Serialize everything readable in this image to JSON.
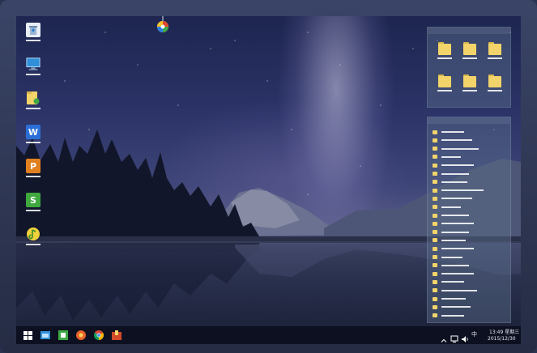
{
  "desktop": {
    "icons": [
      {
        "name": "recycle-bin-icon",
        "color": "#e8eef6"
      },
      {
        "name": "computer-icon",
        "color": "#2f8fd8"
      },
      {
        "name": "user-folder-icon",
        "color": "#f2d46a"
      },
      {
        "name": "wps-writer-icon",
        "color": "#2b6fd6",
        "glyph": "W"
      },
      {
        "name": "wps-presentation-icon",
        "color": "#e0801f",
        "glyph": "P"
      },
      {
        "name": "wps-spreadsheet-icon",
        "color": "#3fa83f",
        "glyph": "S"
      },
      {
        "name": "media-player-icon",
        "color": "#f0d23c"
      }
    ]
  },
  "fences": {
    "top_folders": 6,
    "list_rows": [
      {
        "w": 28
      },
      {
        "w": 38
      },
      {
        "w": 46
      },
      {
        "w": 24
      },
      {
        "w": 40
      },
      {
        "w": 34
      },
      {
        "w": 32
      },
      {
        "w": 52
      },
      {
        "w": 38
      },
      {
        "w": 24
      },
      {
        "w": 34
      },
      {
        "w": 40
      },
      {
        "w": 34
      },
      {
        "w": 30
      },
      {
        "w": 40
      },
      {
        "w": 26
      },
      {
        "w": 34
      },
      {
        "w": 40
      },
      {
        "w": 28
      },
      {
        "w": 44
      },
      {
        "w": 30
      },
      {
        "w": 36
      },
      {
        "w": 28
      }
    ]
  },
  "taskbar": {
    "start_icon": "windows-start-icon",
    "apps": [
      "file-explorer-icon",
      "media-center-icon",
      "qihoo-browser-icon",
      "chrome-icon",
      "archive-icon"
    ],
    "tray": {
      "time": "13:49",
      "weekday": "星期三",
      "date": "2015/12/30",
      "ime": "中"
    }
  }
}
